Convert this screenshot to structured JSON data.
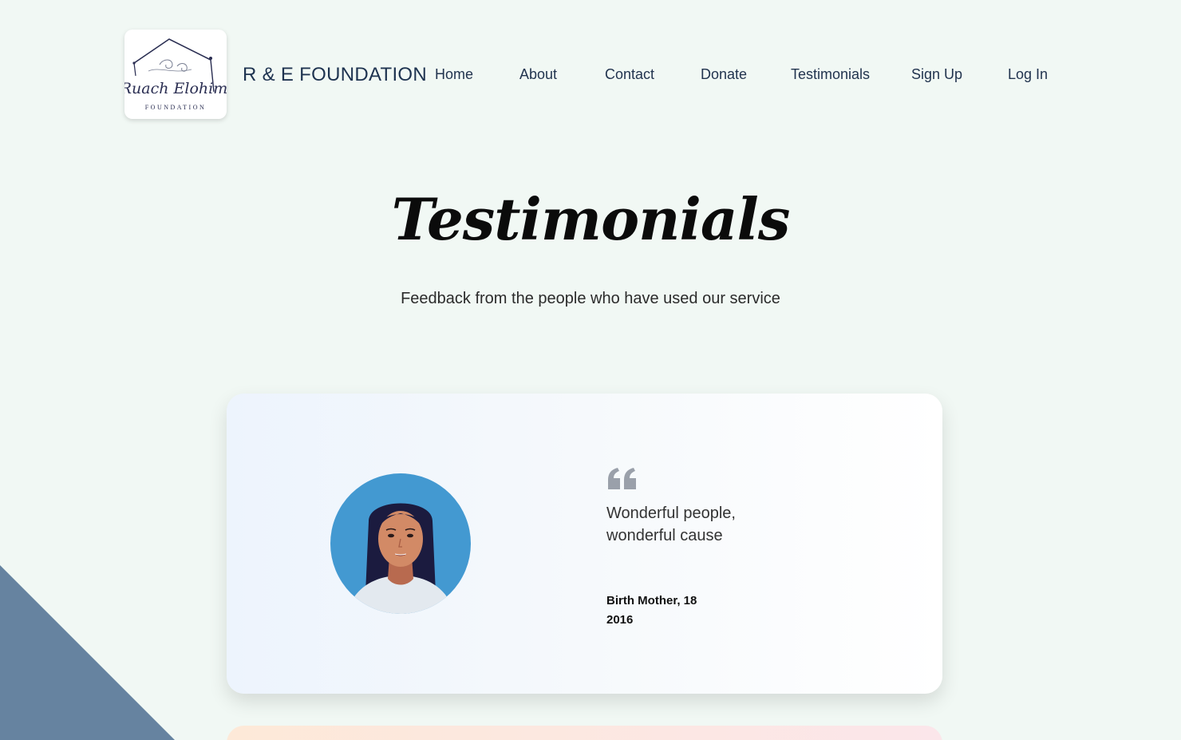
{
  "header": {
    "logo_script": "Ruach Elohim",
    "logo_caption": "FOUNDATION",
    "brand_name": "R & E FOUNDATION",
    "nav": [
      {
        "label": "Home"
      },
      {
        "label": "About"
      },
      {
        "label": "Contact"
      },
      {
        "label": "Donate"
      },
      {
        "label": "Testimonials"
      },
      {
        "label": "Sign Up"
      },
      {
        "label": "Log In"
      }
    ]
  },
  "hero": {
    "title": "Testimonials",
    "subtitle": "Feedback from the people who have used our service"
  },
  "testimonial": {
    "avatar_icon": "woman-avatar-icon",
    "quote_icon": "quote-icon",
    "quote": "Wonderful people, wonderful cause",
    "author": "Birth Mother, 18",
    "year": "2016"
  },
  "colors": {
    "background": "#f1f8f4",
    "corner_triangle": "#6683a0",
    "text_primary": "#22344f",
    "avatar_bg": "#4399d1"
  }
}
